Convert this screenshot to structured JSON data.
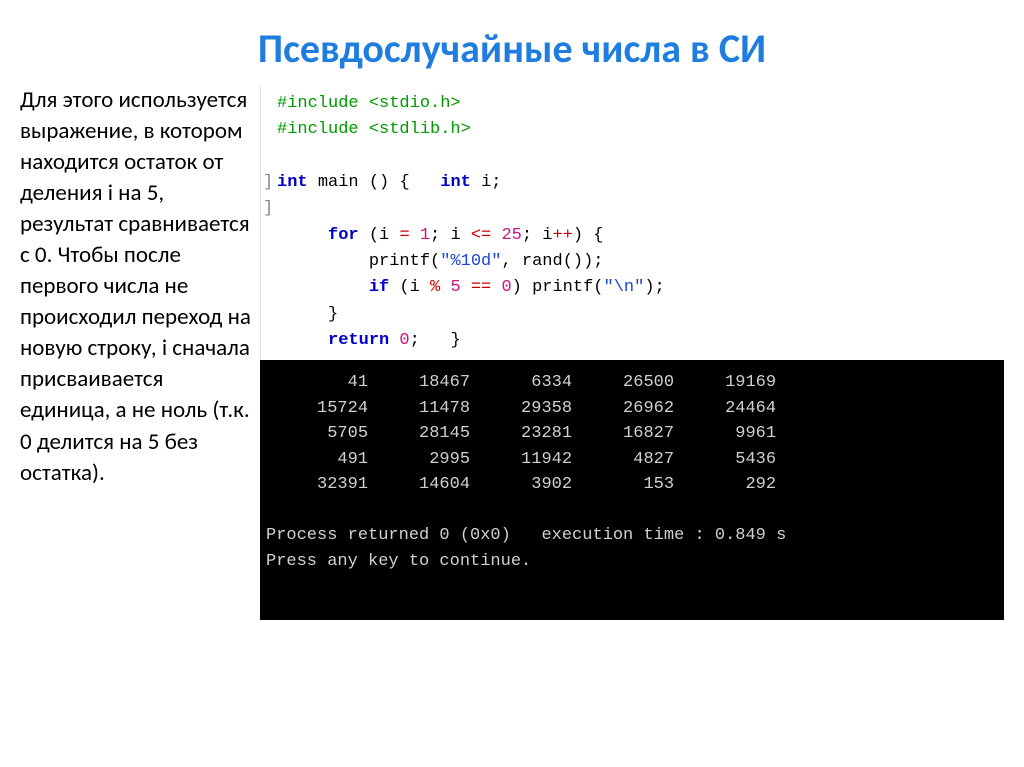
{
  "title": "Псевдослучайные числа в СИ",
  "paragraph": "Для этого используется выражение, в котором находится остаток от деления i на 5, результат сравнивается с 0. Чтобы после первого числа не происходил переход на новую строку, i сначала присваивается единица, а не ноль (т.к. 0 делится на 5 без остатка).",
  "code": {
    "inc1": "#include <stdio.h>",
    "inc2": "#include <stdlib.h>",
    "main_sig_kw1": "int",
    "main_sig_name": "main",
    "main_sig_paren": "()",
    "main_sig_brace": "{",
    "main_decl_kw": "int",
    "main_decl_var": "i",
    "main_decl_semi": ";",
    "for_kw": "for",
    "for_open": "(i ",
    "for_assign": "=",
    "for_one": " 1",
    "for_semi1": ";",
    "for_cond_var": " i ",
    "for_cond_op": "<=",
    "for_cond_val": " 25",
    "for_semi2": ";",
    "for_inc": " i",
    "for_incop": "++",
    "for_close": ") {",
    "printf1_name": "printf",
    "printf1_open": "(",
    "printf1_fmt": "\"%10d\"",
    "printf1_comma": ", ",
    "printf1_rand": "rand",
    "printf1_randp": "()",
    "printf1_close": ");",
    "if_kw": "if",
    "if_open": " (i ",
    "if_mod": "%",
    "if_five": " 5 ",
    "if_eq": "==",
    "if_zero": " 0",
    "if_close": ") ",
    "printf2_name": "printf",
    "printf2_open": "(",
    "printf2_fmt": "\"\\n\"",
    "printf2_close": ");",
    "brace_close_inner": "}",
    "return_kw": "return",
    "return_val": " 0",
    "return_semi": ";",
    "brace_close_outer": "}"
  },
  "console": {
    "rows": [
      [
        "41",
        "18467",
        "6334",
        "26500",
        "19169"
      ],
      [
        "15724",
        "11478",
        "29358",
        "26962",
        "24464"
      ],
      [
        "5705",
        "28145",
        "23281",
        "16827",
        "9961"
      ],
      [
        "491",
        "2995",
        "11942",
        "4827",
        "5436"
      ],
      [
        "32391",
        "14604",
        "3902",
        "153",
        "292"
      ]
    ],
    "status1": "Process returned 0 (0x0)   execution time : 0.849 s",
    "status2": "Press any key to continue."
  }
}
